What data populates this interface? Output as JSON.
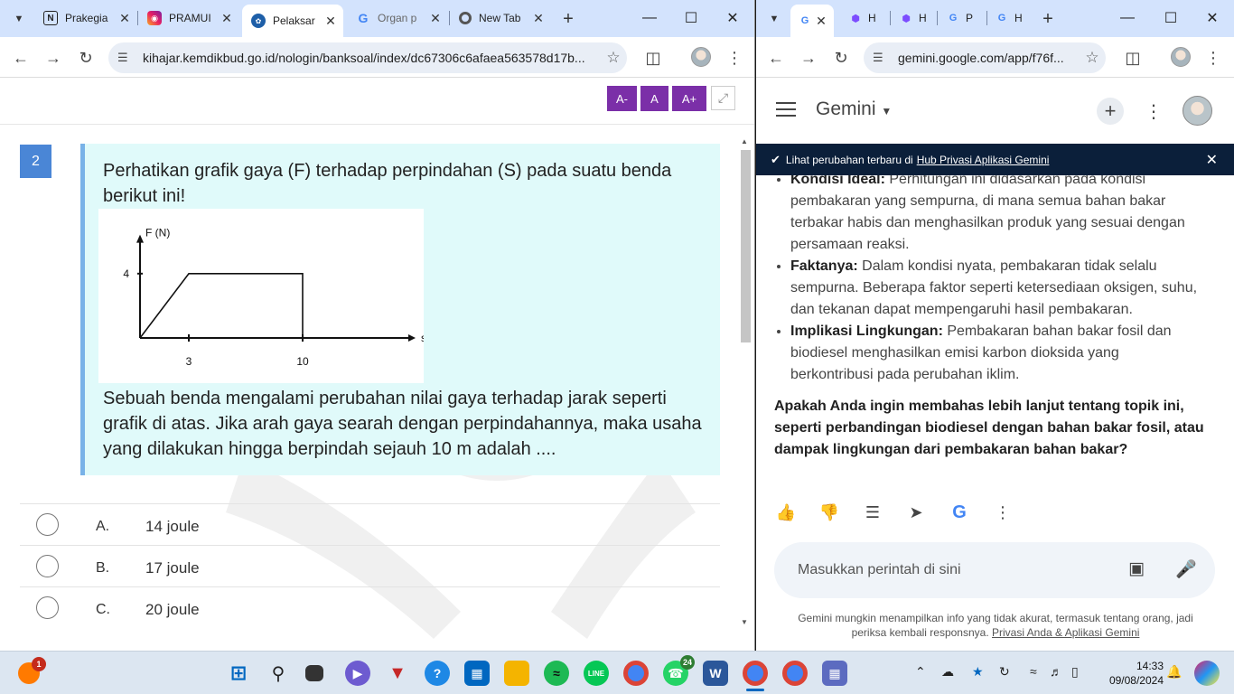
{
  "left_browser": {
    "tabs": [
      {
        "title": "Prakegia",
        "icon": "notion-icon"
      },
      {
        "title": "PRAMUI",
        "icon": "instagram-icon"
      },
      {
        "title": "Pelaksar",
        "icon": "kemdikbud-icon"
      },
      {
        "title": "Organ p",
        "icon": "google-icon"
      },
      {
        "title": "New Tab",
        "icon": "chrome-icon"
      }
    ],
    "url": "kihajar.kemdikbud.go.id/nologin/banksoal/index/dc67306c6afaea563578d17b..."
  },
  "question": {
    "font_buttons": [
      "A-",
      "A",
      "A+"
    ],
    "number": "2",
    "text_intro": "Perhatikan grafik gaya (F) terhadap perpindahan (S) pada suatu benda berikut ini!",
    "text_body": "Sebuah benda mengalami perubahan nilai gaya terhadap jarak seperti grafik di atas. Jika arah gaya searah dengan perpindahannya, maka usaha yang dilakukan hingga berpindah sejauh 10 m adalah ....",
    "options": [
      {
        "letter": "A.",
        "value": "14 joule"
      },
      {
        "letter": "B.",
        "value": "17 joule"
      },
      {
        "letter": "C.",
        "value": "20 joule"
      }
    ]
  },
  "chart_data": {
    "type": "line",
    "title": "",
    "xlabel": "s (m)",
    "ylabel": "F (N)",
    "x_ticks": [
      "3",
      "10"
    ],
    "y_ticks": [
      "4"
    ],
    "series": [
      {
        "x": [
          0,
          3,
          10,
          10
        ],
        "y": [
          0,
          4,
          4,
          0
        ]
      }
    ],
    "xlim": [
      0,
      13.5
    ],
    "ylim": [
      0,
      6.2
    ],
    "grid": false
  },
  "right_browser": {
    "tabs": [
      "G",
      "H",
      "H",
      "P",
      "H"
    ],
    "url": "gemini.google.com/app/f76f..."
  },
  "gemini": {
    "title": "Gemini",
    "banner_text": "Lihat perubahan terbaru di",
    "banner_link": "Hub Privasi Aplikasi Gemini",
    "bullets": [
      {
        "label": "Kondisi Ideal:",
        "text": "Perhitungan ini didasarkan pada kondisi pembakaran yang sempurna, di mana semua bahan bakar terbakar habis dan menghasilkan produk yang sesuai dengan persamaan reaksi."
      },
      {
        "label": "Faktanya:",
        "text": "Dalam kondisi nyata, pembakaran tidak selalu sempurna. Beberapa faktor seperti ketersediaan oksigen, suhu, dan tekanan dapat mempengaruhi hasil pembakaran."
      },
      {
        "label": "Implikasi Lingkungan:",
        "text": "Pembakaran bahan bakar fosil dan biodiesel menghasilkan emisi karbon dioksida yang berkontribusi pada perubahan iklim."
      }
    ],
    "question": "Apakah Anda ingin membahas lebih lanjut tentang topik ini, seperti perbandingan biodiesel dengan bahan bakar fosil, atau dampak lingkungan dari pembakaran bahan bakar?",
    "input_placeholder": "Masukkan perintah di sini",
    "footer_text": "Gemini mungkin menampilkan info yang tidak akurat, termasuk tentang orang, jadi periksa kembali responsnya.",
    "footer_link": "Privasi Anda & Aplikasi Gemini"
  },
  "taskbar": {
    "notification_badge": "1",
    "whatsapp_badge": "24",
    "time": "14:33",
    "date": "09/08/2024",
    "colors": {
      "accent": "#0067c0",
      "purple": "#7b2fa8",
      "gemini_banner": "#0b1f3a"
    }
  }
}
